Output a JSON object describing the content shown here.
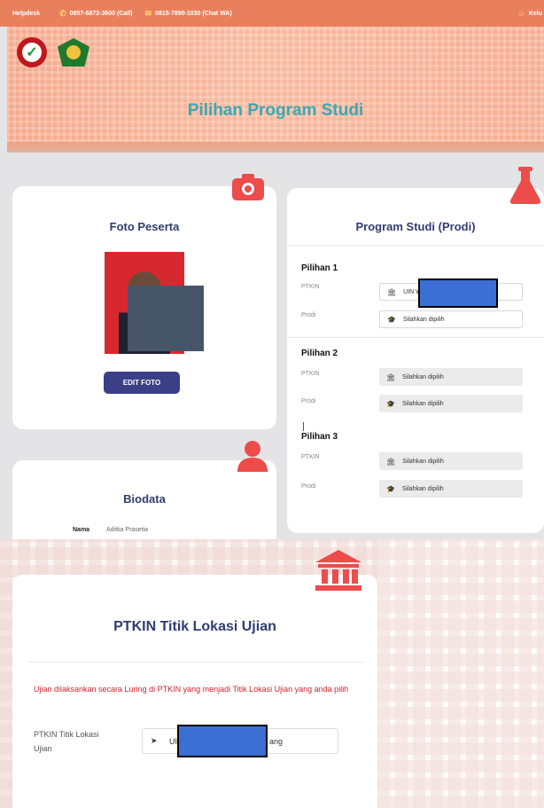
{
  "topbar": {
    "helpdesk": "Helpdesk",
    "phone_call": "0857-6872-3600 (Call)",
    "phone_wa": "0815-7890-1030 (Chat WA)",
    "logout": "Kelu"
  },
  "hero": {
    "title": "Pilihan Program Studi"
  },
  "foto": {
    "title": "Foto Peserta",
    "edit_button": "EDIT FOTO"
  },
  "biodata": {
    "title": "Biodata",
    "name_label": "Nama",
    "name_value": "Adittia Prasetia"
  },
  "prodi": {
    "title": "Program Studi (Prodi)",
    "pilihan": [
      {
        "heading": "Pilihan 1",
        "ptkin_label": "PTKIN",
        "ptkin_value": "UIN W",
        "prodi_label": "Prodi",
        "prodi_value": "Silahkan dipilih"
      },
      {
        "heading": "Pilihan 2",
        "ptkin_label": "PTKIN",
        "ptkin_value": "Silahkan dipilih",
        "prodi_label": "Prodi",
        "prodi_value": "Silahkan dipilih"
      },
      {
        "heading": "Pilihan 3",
        "ptkin_label": "PTKIN",
        "ptkin_value": "Silahkan dipilih",
        "prodi_label": "Prodi",
        "prodi_value": "Silahkan dipilih"
      }
    ]
  },
  "lokasi": {
    "title": "PTKIN Titik Lokasi Ujian",
    "notice": "Ujian dilaksankan secara Luring di PTKIN yang menjadi Titik Lokasi Ujian yang anda pilih",
    "field_label": "PTKIN Titik Lokasi Ujian",
    "field_value_start": "UIN V",
    "field_value_end": "ang"
  },
  "colors": {
    "accent": "#ee4b4b",
    "navy": "#2f3d6f",
    "hero": "#f6a98d",
    "teal": "#3aa8b2"
  }
}
